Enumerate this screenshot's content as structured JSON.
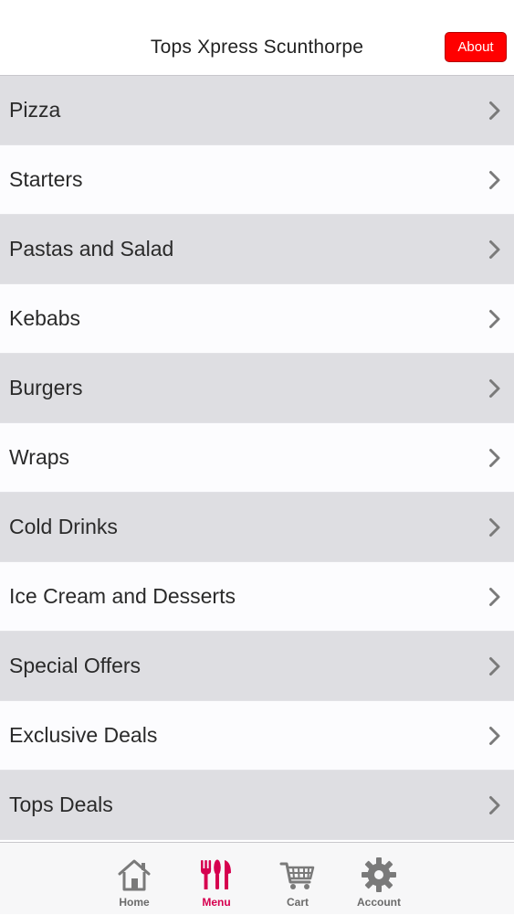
{
  "header": {
    "title": "Tops Xpress Scunthorpe",
    "about_label": "About"
  },
  "colors": {
    "accent": "#d6004f",
    "about_button": "#ff0000",
    "icon_gray": "#7a7a7a"
  },
  "menu": [
    {
      "label": "Pizza",
      "icon": "chevron-right-icon"
    },
    {
      "label": "Starters",
      "icon": "chevron-right-icon"
    },
    {
      "label": "Pastas and Salad",
      "icon": "chevron-right-icon"
    },
    {
      "label": "Kebabs",
      "icon": "chevron-right-icon"
    },
    {
      "label": "Burgers",
      "icon": "chevron-right-icon"
    },
    {
      "label": "Wraps",
      "icon": "chevron-right-icon"
    },
    {
      "label": "Cold Drinks",
      "icon": "chevron-right-icon"
    },
    {
      "label": "Ice Cream and Desserts",
      "icon": "chevron-right-icon"
    },
    {
      "label": "Special Offers",
      "icon": "chevron-right-icon"
    },
    {
      "label": "Exclusive Deals",
      "icon": "chevron-right-icon"
    },
    {
      "label": "Tops Deals",
      "icon": "chevron-right-icon"
    }
  ],
  "tabs": [
    {
      "label": "Home",
      "icon": "home-icon",
      "active": false
    },
    {
      "label": "Menu",
      "icon": "fork-knife-icon",
      "active": true
    },
    {
      "label": "Cart",
      "icon": "cart-icon",
      "active": false
    },
    {
      "label": "Account",
      "icon": "gear-icon",
      "active": false
    }
  ]
}
